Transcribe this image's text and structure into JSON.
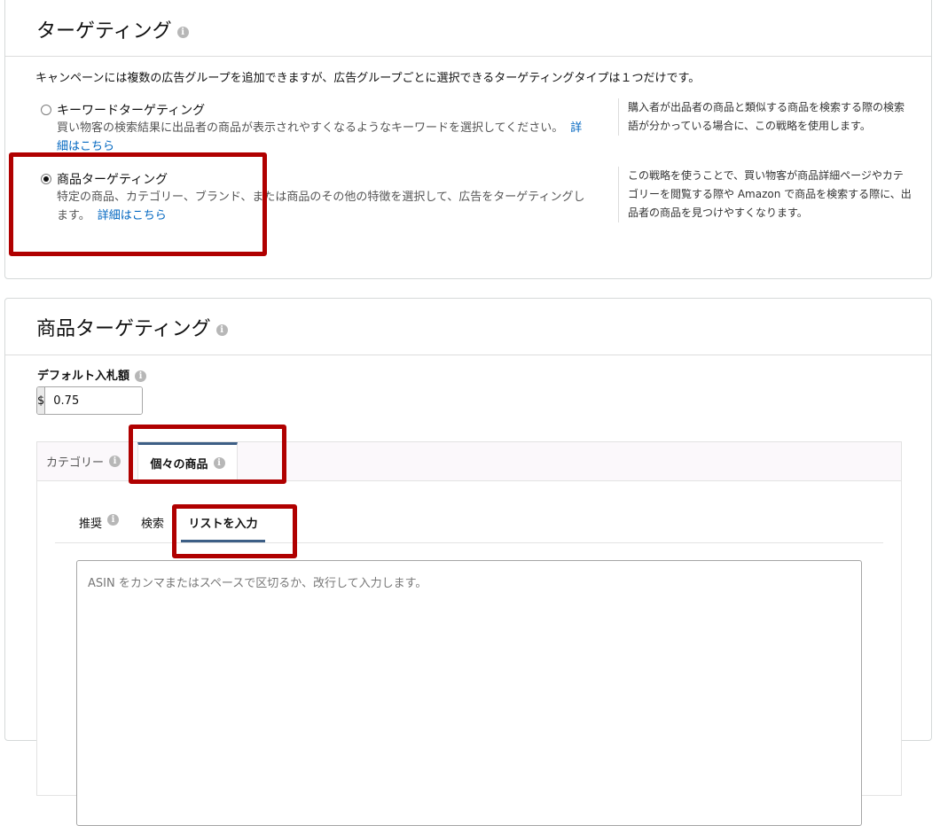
{
  "targeting_panel": {
    "title": "ターゲティング",
    "intro": "キャンペーンには複数の広告グループを追加できますが、広告グループごとに選択できるターゲティングタイプは１つだけです。",
    "options": [
      {
        "label": "キーワードターゲティング",
        "selected": false,
        "description": "買い物客の検索結果に出品者の商品が表示されやすくなるようなキーワードを選択してください。",
        "link": "詳細はこちら",
        "note": "購入者が出品者の商品と類似する商品を検索する際の検索語が分かっている場合に、この戦略を使用します。"
      },
      {
        "label": "商品ターゲティング",
        "selected": true,
        "description": "特定の商品、カテゴリー、ブランド、または商品のその他の特徴を選択して、広告をターゲティングします。",
        "link": "詳細はこちら",
        "note": "この戦略を使うことで、買い物客が商品詳細ページやカテゴリーを閲覧する際や Amazon で商品を検索する際に、出品者の商品を見つけやすくなります。"
      }
    ]
  },
  "product_targeting_panel": {
    "title": "商品ターゲティング",
    "default_bid_label": "デフォルト入札額",
    "currency": "$",
    "default_bid_value": "0.75",
    "tabs": [
      {
        "label": "カテゴリー",
        "active": false
      },
      {
        "label": "個々の商品",
        "active": true
      }
    ],
    "subtabs": [
      {
        "label": "推奨",
        "active": false
      },
      {
        "label": "検索",
        "active": false
      },
      {
        "label": "リストを入力",
        "active": true
      }
    ],
    "asin_placeholder": "ASIN をカンマまたはスペースで区切るか、改行して入力します。"
  },
  "icons": {
    "info": "info-icon",
    "radio": "radio-button"
  },
  "colors": {
    "link": "#0066c0",
    "highlight_box": "#b00000",
    "active_tab_border": "#3d5f86"
  }
}
